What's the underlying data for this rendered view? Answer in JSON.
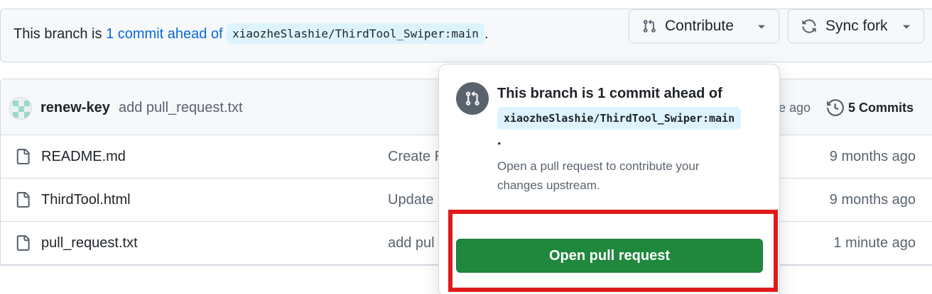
{
  "banner": {
    "prefix": "This branch is",
    "link": "1 commit ahead of",
    "upstream": "xiaozheSlashie/ThirdTool_Swiper:main",
    "suffix": "."
  },
  "buttons": {
    "contribute": "Contribute",
    "sync": "Sync fork"
  },
  "latest_commit": {
    "author": "renew-key",
    "message": "add pull_request.txt",
    "time_partial": "e ago",
    "commits_label": "5 Commits"
  },
  "files": [
    {
      "name": "README.md",
      "message": "Create R",
      "date": "9 months ago"
    },
    {
      "name": "ThirdTool.html",
      "message": "Update",
      "date": "9 months ago"
    },
    {
      "name": "pull_request.txt",
      "message": "add pul",
      "date": "1 minute ago"
    }
  ],
  "popover": {
    "title": "This branch is 1 commit ahead of",
    "upstream": "xiaozheSlashie/ThirdTool_Swiper:main",
    "period": ".",
    "description": "Open a pull request to contribute your changes upstream.",
    "button": "Open pull request"
  },
  "colors": {
    "accent_link": "#0969da",
    "primary_button": "#1f883d",
    "highlight_box": "#e01a1a",
    "code_background": "#ddf4ff"
  },
  "icons": {
    "contribute": "git-pull-request-icon",
    "sync": "sync-icon",
    "history": "history-icon",
    "file": "file-icon"
  }
}
